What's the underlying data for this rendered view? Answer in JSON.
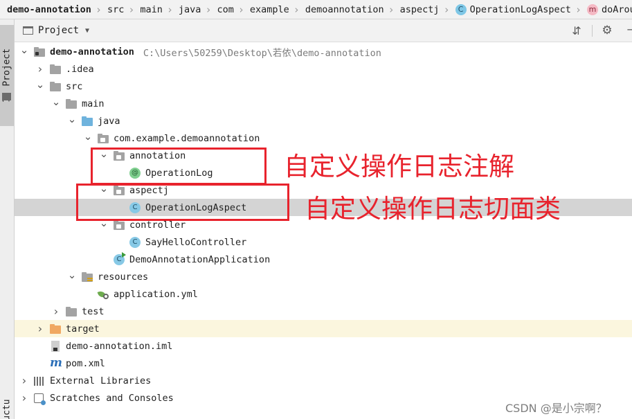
{
  "breadcrumb": [
    {
      "label": "demo-annotation",
      "icon": ""
    },
    {
      "label": "src",
      "icon": ""
    },
    {
      "label": "main",
      "icon": ""
    },
    {
      "label": "java",
      "icon": ""
    },
    {
      "label": "com",
      "icon": ""
    },
    {
      "label": "example",
      "icon": ""
    },
    {
      "label": "demoannotation",
      "icon": ""
    },
    {
      "label": "aspectj",
      "icon": ""
    },
    {
      "label": "OperationLogAspect",
      "icon": "class-icon",
      "glyph": "C"
    },
    {
      "label": "doAround",
      "icon": "method-icon",
      "glyph": "m"
    }
  ],
  "toolstrip": {
    "project_tab": "1: Project",
    "structure_tab": "Structure"
  },
  "panel": {
    "title": "Project",
    "dropdown_glyph": "▼",
    "collapse_glyph": "⇵",
    "gear_glyph": "⚙",
    "minimize_glyph": "–"
  },
  "tree": {
    "root": {
      "label": "demo-annotation",
      "path": "C:\\Users\\50259\\Desktop\\若依\\demo-annotation"
    },
    "idea": "idea",
    "src": "src",
    "main": "main",
    "java": "java",
    "package": "com.example.demoannotation",
    "annotation_pkg": "annotation",
    "operation_log": "OperationLog",
    "aspectj_pkg": "aspectj",
    "operation_log_aspect": "OperationLogAspect",
    "controller_pkg": "controller",
    "say_hello_controller": "SayHelloController",
    "demo_app": "DemoAnnotationApplication",
    "resources": "resources",
    "application_yml": "application.yml",
    "test": "test",
    "target": "target",
    "iml": "demo-annotation.iml",
    "pom": "pom.xml",
    "external_libraries": "External Libraries",
    "scratches": "Scratches and Consoles"
  },
  "glyphs": {
    "expanded": "⌄",
    "collapsed": "›",
    "class": "C",
    "annotation": "@"
  },
  "annotations": {
    "note_annotation": "自定义操作日志注解",
    "note_aspect": "自定义操作日志切面类",
    "accent_color": "#e8232d"
  },
  "watermark": "CSDN @是小宗啊？",
  "selected_item": "OperationLogAspect"
}
